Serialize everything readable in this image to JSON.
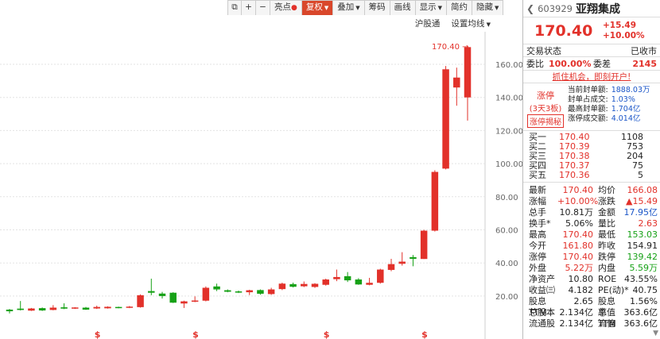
{
  "toolbar": {
    "buttons": [
      "亮点",
      "复权",
      "叠加",
      "筹码",
      "画线",
      "显示",
      "简约",
      "隐藏"
    ],
    "highlight_dot": "●"
  },
  "sub_toolbar": {
    "hgt": "沪股通",
    "ma": "设置均线"
  },
  "chart_data": {
    "type": "candlestick",
    "y_ticks": [
      20.0,
      40.0,
      60.0,
      80.0,
      100.0,
      120.0,
      140.0,
      160.0
    ],
    "ylim": [
      7,
      172
    ],
    "max_label": "170.40",
    "dividend_marker": "$",
    "candles": [
      {
        "o": 11.8,
        "c": 10.8,
        "h": 12.2,
        "l": 9.5
      },
      {
        "o": 12.4,
        "c": 11.6,
        "h": 17.0,
        "l": 11.3
      },
      {
        "o": 11.2,
        "c": 12.5,
        "h": 12.8,
        "l": 11.0
      },
      {
        "o": 12.7,
        "c": 11.3,
        "h": 13.1,
        "l": 11.0
      },
      {
        "o": 11.6,
        "c": 13.0,
        "h": 14.5,
        "l": 11.4
      },
      {
        "o": 13.2,
        "c": 12.4,
        "h": 15.6,
        "l": 12.1
      },
      {
        "o": 12.5,
        "c": 13.1,
        "h": 13.3,
        "l": 12.2
      },
      {
        "o": 13.0,
        "c": 11.8,
        "h": 13.4,
        "l": 11.6
      },
      {
        "o": 12.5,
        "c": 13.4,
        "h": 14.2,
        "l": 12.2
      },
      {
        "o": 12.6,
        "c": 13.5,
        "h": 13.8,
        "l": 12.4
      },
      {
        "o": 13.4,
        "c": 12.8,
        "h": 13.6,
        "l": 12.6
      },
      {
        "o": 12.9,
        "c": 13.6,
        "h": 14.0,
        "l": 12.7
      },
      {
        "o": 13.3,
        "c": 20.5,
        "h": 21.0,
        "l": 13.0
      },
      {
        "o": 23.0,
        "c": 22.0,
        "h": 30.5,
        "l": 20.5
      },
      {
        "o": 21.5,
        "c": 20.0,
        "h": 22.5,
        "l": 18.5
      },
      {
        "o": 22.0,
        "c": 16.0,
        "h": 22.3,
        "l": 15.8
      },
      {
        "o": 15.5,
        "c": 16.8,
        "h": 17.2,
        "l": 12.8
      },
      {
        "o": 16.8,
        "c": 17.3,
        "h": 19.8,
        "l": 16.3
      },
      {
        "o": 17.2,
        "c": 25.0,
        "h": 25.8,
        "l": 16.8
      },
      {
        "o": 25.8,
        "c": 24.0,
        "h": 27.5,
        "l": 23.0
      },
      {
        "o": 23.5,
        "c": 22.6,
        "h": 24.0,
        "l": 22.3
      },
      {
        "o": 22.8,
        "c": 22.2,
        "h": 23.3,
        "l": 21.8
      },
      {
        "o": 22.3,
        "c": 23.5,
        "h": 23.8,
        "l": 20.6
      },
      {
        "o": 23.6,
        "c": 21.4,
        "h": 24.0,
        "l": 20.8
      },
      {
        "o": 21.2,
        "c": 24.0,
        "h": 25.0,
        "l": 20.7
      },
      {
        "o": 24.2,
        "c": 27.5,
        "h": 28.1,
        "l": 23.6
      },
      {
        "o": 27.2,
        "c": 25.6,
        "h": 28.1,
        "l": 25.2
      },
      {
        "o": 25.9,
        "c": 27.3,
        "h": 28.8,
        "l": 25.4
      },
      {
        "o": 25.5,
        "c": 27.4,
        "h": 27.8,
        "l": 24.9
      },
      {
        "o": 26.8,
        "c": 30.0,
        "h": 30.5,
        "l": 26.3
      },
      {
        "o": 30.2,
        "c": 31.5,
        "h": 36.0,
        "l": 29.0
      },
      {
        "o": 32.0,
        "c": 29.5,
        "h": 34.5,
        "l": 28.5
      },
      {
        "o": 30.0,
        "c": 27.0,
        "h": 30.8,
        "l": 26.8
      },
      {
        "o": 26.8,
        "c": 28.0,
        "h": 31.0,
        "l": 26.5
      },
      {
        "o": 28.0,
        "c": 36.0,
        "h": 36.5,
        "l": 27.5
      },
      {
        "o": 35.8,
        "c": 39.3,
        "h": 42.5,
        "l": 35.0
      },
      {
        "o": 39.5,
        "c": 40.8,
        "h": 46.5,
        "l": 38.4
      },
      {
        "o": 43.5,
        "c": 42.5,
        "h": 44.8,
        "l": 38.0
      },
      {
        "o": 42.4,
        "c": 59.5,
        "h": 60.0,
        "l": 42.4
      },
      {
        "o": 59.5,
        "c": 95.0,
        "h": 96.0,
        "l": 59.0
      },
      {
        "o": 97.0,
        "c": 157.0,
        "h": 159.0,
        "l": 96.5
      },
      {
        "o": 146.0,
        "c": 152.0,
        "h": 158.0,
        "l": 135.0
      },
      {
        "o": 140.0,
        "c": 170.4,
        "h": 171.0,
        "l": 126.0
      }
    ],
    "dividend_indices": [
      8,
      17,
      29,
      38
    ]
  },
  "stock": {
    "code": "603929",
    "name": "亚翔集成",
    "price": "170.40",
    "change": "+15.49",
    "change_pct": "+10.00%",
    "status_label": "交易状态",
    "status_value": "已收市",
    "weibi_label": "委比",
    "weibi_value": "100.00%",
    "weicha_label": "委差",
    "weicha_value": "2145",
    "promo": "抓住机会，即刻开户!",
    "limit": {
      "title": "涨停",
      "days": "(3天3板)",
      "button": "涨停揭秘",
      "rows": [
        {
          "k": "当前封单额:",
          "v": "1888.03万"
        },
        {
          "k": "封单占成交:",
          "v": "1.03%"
        },
        {
          "k": "最高封单额:",
          "v": "1.704亿"
        },
        {
          "k": "涨停成交额:",
          "v": "4.014亿"
        }
      ]
    },
    "bids": [
      {
        "label": "买一",
        "price": "170.40",
        "vol": "1108"
      },
      {
        "label": "买二",
        "price": "170.39",
        "vol": "753"
      },
      {
        "label": "买三",
        "price": "170.38",
        "vol": "204"
      },
      {
        "label": "买四",
        "price": "170.37",
        "vol": "75"
      },
      {
        "label": "买五",
        "price": "170.36",
        "vol": "5"
      }
    ],
    "stats": [
      {
        "k1": "最新",
        "v1": "170.40",
        "c1": "red",
        "k2": "均价",
        "v2": "166.08",
        "c2": "red"
      },
      {
        "k1": "涨幅",
        "v1": "+10.00%",
        "c1": "red",
        "k2": "涨跌",
        "v2": "▲15.49",
        "c2": "red"
      },
      {
        "k1": "总手",
        "v1": "10.81万",
        "c1": "",
        "k2": "金额",
        "v2": "17.95亿",
        "c2": "blue"
      },
      {
        "k1": "换手*",
        "v1": "5.06%",
        "c1": "",
        "k2": "量比",
        "v2": "2.63",
        "c2": "red"
      },
      {
        "k1": "最高",
        "v1": "170.40",
        "c1": "red",
        "k2": "最低",
        "v2": "153.03",
        "c2": "green"
      },
      {
        "k1": "今开",
        "v1": "161.80",
        "c1": "red",
        "k2": "昨收",
        "v2": "154.91",
        "c2": ""
      },
      {
        "k1": "涨停",
        "v1": "170.40",
        "c1": "red",
        "k2": "跌停",
        "v2": "139.42",
        "c2": "green"
      },
      {
        "k1": "外盘",
        "v1": "5.22万",
        "c1": "red",
        "k2": "内盘",
        "v2": "5.59万",
        "c2": "green"
      },
      {
        "k1": "净资产",
        "v1": "10.80",
        "c1": "",
        "k2": "ROE",
        "v2": "43.55%",
        "c2": ""
      },
      {
        "k1": "收益㈢",
        "v1": "4.182",
        "c1": "",
        "k2": "PE(动)*",
        "v2": "40.75",
        "c2": ""
      },
      {
        "k1": "股息TTM",
        "v1": "2.65",
        "c1": "",
        "k2": "股息率TTM",
        "v2": "1.56%",
        "c2": ""
      },
      {
        "k1": "总股本",
        "v1": "2.134亿",
        "c1": "",
        "k2": "总值",
        "v2": "363.6亿",
        "c2": ""
      },
      {
        "k1": "流通股",
        "v1": "2.134亿",
        "c1": "",
        "k2": "流值",
        "v2": "363.6亿",
        "c2": ""
      }
    ]
  },
  "colors": {
    "up": "#e2312a",
    "down": "#16a116",
    "grid": "#e3e3e3"
  }
}
